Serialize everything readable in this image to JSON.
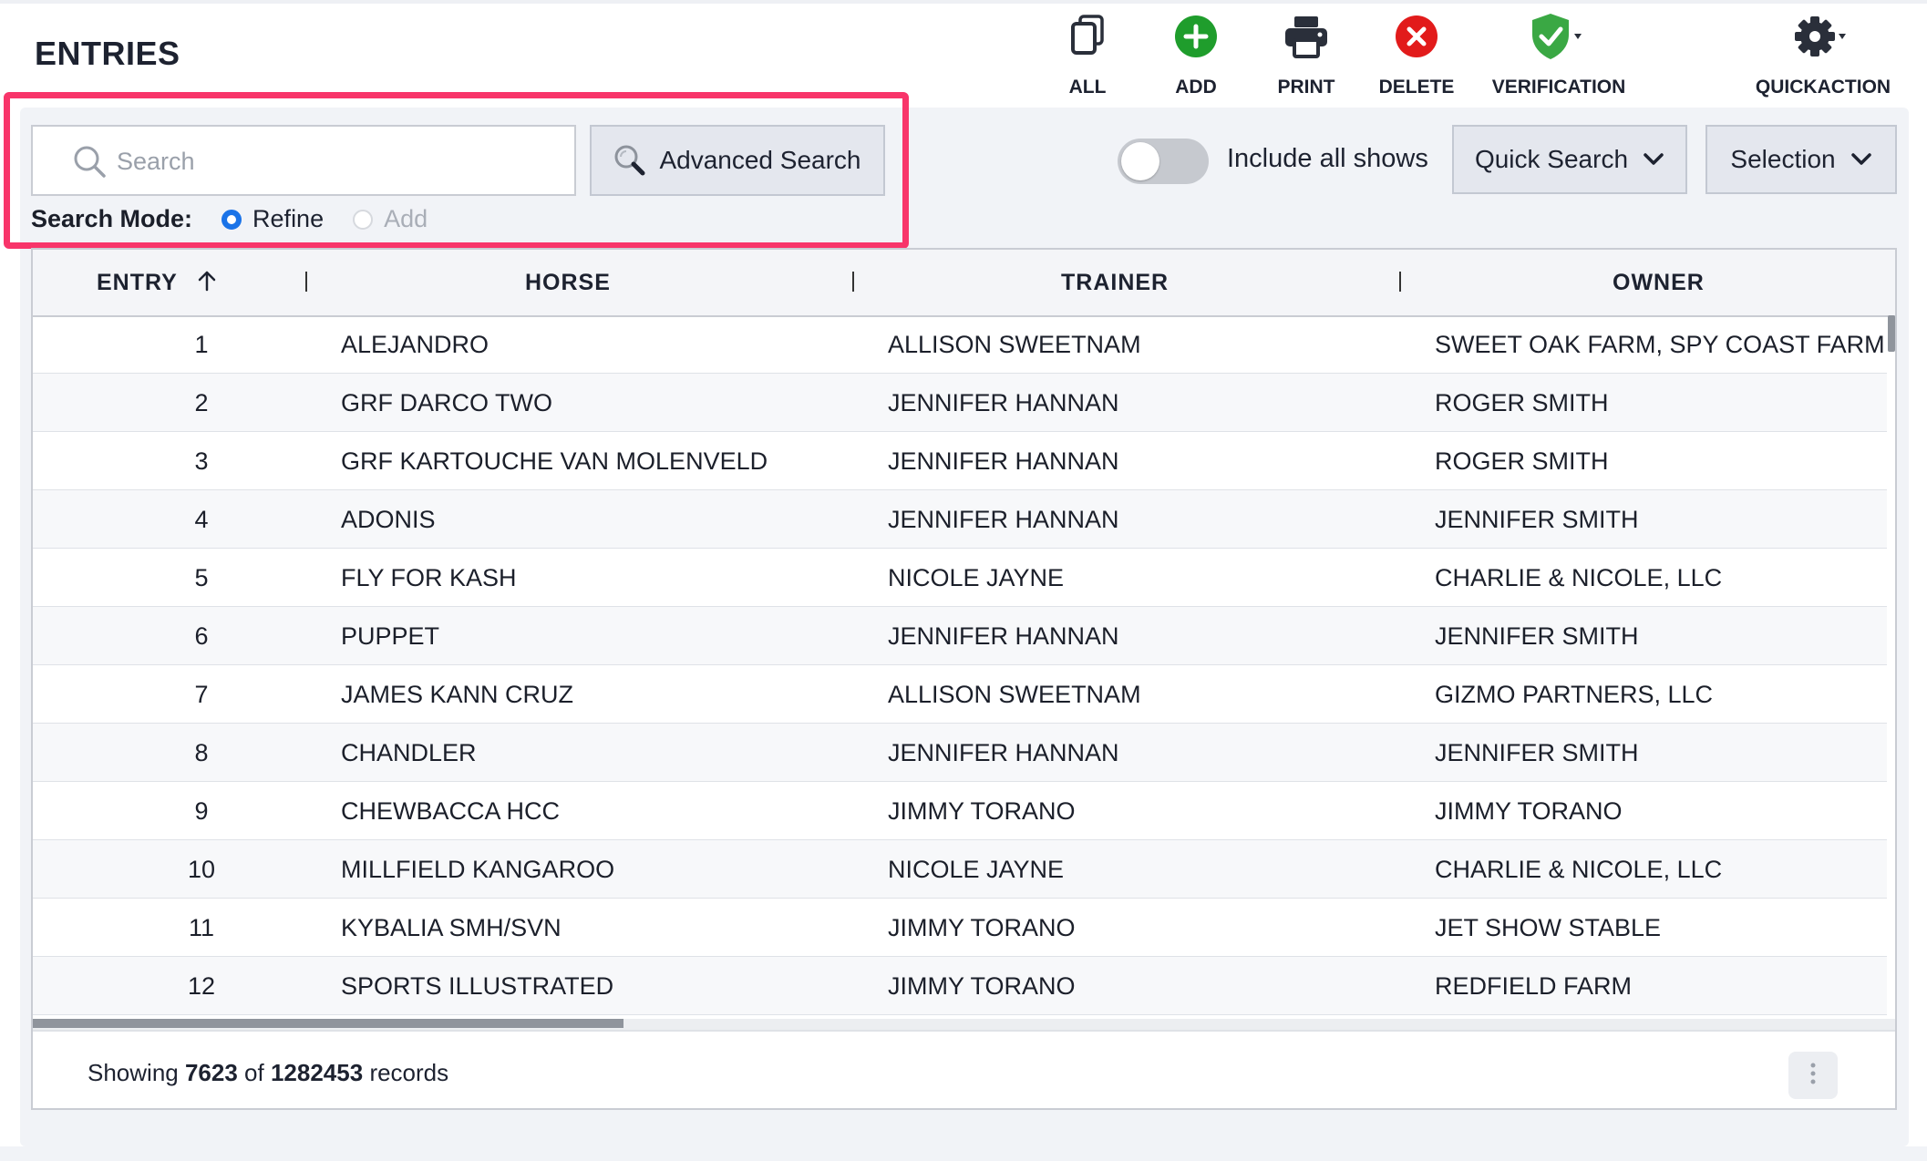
{
  "page": {
    "title": "ENTRIES"
  },
  "toolbar": [
    {
      "label": "ALL",
      "icon": "copy-icon"
    },
    {
      "label": "ADD",
      "icon": "plus-circle-icon",
      "color": "#1f9d2c"
    },
    {
      "label": "PRINT",
      "icon": "printer-icon"
    },
    {
      "label": "DELETE",
      "icon": "x-circle-icon",
      "color": "#e21b1b"
    },
    {
      "label": "VERIFICATION",
      "icon": "shield-check-icon",
      "color": "#3aa844"
    },
    {
      "label": "QUICKACTION",
      "icon": "gear-icon"
    }
  ],
  "search": {
    "placeholder": "Search",
    "value": "",
    "advanced_label": "Advanced Search",
    "mode_label": "Search Mode:",
    "modes": [
      {
        "label": "Refine",
        "selected": true,
        "enabled": true
      },
      {
        "label": "Add",
        "selected": false,
        "enabled": false
      }
    ]
  },
  "filters": {
    "include_all_shows_label": "Include all shows",
    "include_all_shows": false,
    "quick_search_label": "Quick Search",
    "selection_label": "Selection"
  },
  "table": {
    "columns": [
      {
        "label": "ENTRY",
        "sort": "ascending"
      },
      {
        "label": "HORSE"
      },
      {
        "label": "TRAINER"
      },
      {
        "label": "OWNER"
      }
    ],
    "rows": [
      {
        "entry": "1",
        "horse": "ALEJANDRO",
        "trainer": "ALLISON SWEETNAM",
        "owner": "SWEET OAK FARM, SPY COAST FARM"
      },
      {
        "entry": "2",
        "horse": "GRF DARCO TWO",
        "trainer": "JENNIFER HANNAN",
        "owner": "ROGER SMITH"
      },
      {
        "entry": "3",
        "horse": "GRF KARTOUCHE VAN MOLENVELD",
        "trainer": "JENNIFER HANNAN",
        "owner": "ROGER SMITH"
      },
      {
        "entry": "4",
        "horse": "ADONIS",
        "trainer": "JENNIFER HANNAN",
        "owner": "JENNIFER SMITH"
      },
      {
        "entry": "5",
        "horse": "FLY FOR KASH",
        "trainer": "NICOLE JAYNE",
        "owner": "CHARLIE & NICOLE, LLC"
      },
      {
        "entry": "6",
        "horse": "PUPPET",
        "trainer": "JENNIFER HANNAN",
        "owner": "JENNIFER SMITH"
      },
      {
        "entry": "7",
        "horse": "JAMES KANN CRUZ",
        "trainer": "ALLISON SWEETNAM",
        "owner": "GIZMO PARTNERS, LLC"
      },
      {
        "entry": "8",
        "horse": "CHANDLER",
        "trainer": "JENNIFER HANNAN",
        "owner": "JENNIFER SMITH"
      },
      {
        "entry": "9",
        "horse": "CHEWBACCA HCC",
        "trainer": "JIMMY TORANO",
        "owner": "JIMMY TORANO"
      },
      {
        "entry": "10",
        "horse": "MILLFIELD KANGAROO",
        "trainer": "NICOLE JAYNE",
        "owner": "CHARLIE & NICOLE, LLC"
      },
      {
        "entry": "11",
        "horse": "KYBALIA SMH/SVN",
        "trainer": "JIMMY TORANO",
        "owner": "JET SHOW STABLE"
      },
      {
        "entry": "12",
        "horse": "SPORTS ILLUSTRATED",
        "trainer": "JIMMY TORANO",
        "owner": "REDFIELD FARM"
      }
    ]
  },
  "footer": {
    "prefix": "Showing",
    "shown": "7623",
    "of": "of",
    "total": "1282453",
    "suffix": "records"
  },
  "colors": {
    "highlight": "#f8356a",
    "radio_selected": "#1a73e8"
  }
}
